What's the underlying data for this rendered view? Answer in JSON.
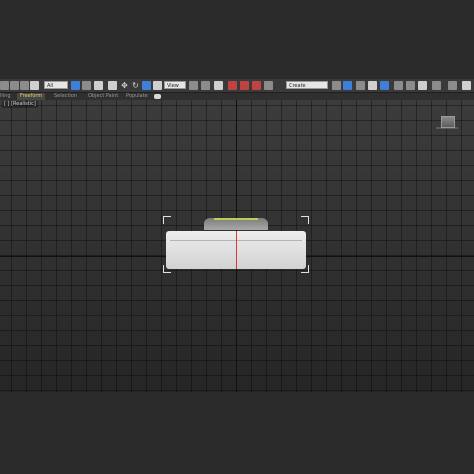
{
  "toolbar": {
    "selection_filter": "All",
    "reference_coordinate": "View",
    "named_selection_set": "Create Selection Se",
    "icons": [
      "undo-icon",
      "redo-icon",
      "link-icon",
      "unlink-icon",
      "bind-spacewarp-icon",
      "select-object-icon",
      "select-by-name-icon",
      "rectangular-selection-icon",
      "window-crossing-icon",
      "select-move-icon",
      "select-rotate-icon",
      "select-scale-icon",
      "place-icon",
      "use-pivot-center-icon",
      "keyboard-shortcut-override-icon",
      "snap-toggle-icon",
      "angle-snap-icon",
      "percent-snap-icon",
      "spinner-snap-icon",
      "edit-named-selection-icon",
      "mirror-icon",
      "align-icon",
      "toggle-scene-explorer-icon",
      "layer-explorer-icon",
      "toggle-ribbon-icon",
      "curve-editor-icon",
      "schematic-view-icon",
      "material-editor-icon",
      "render-setup-icon",
      "rendered-frame-window-icon",
      "render-production-icon"
    ]
  },
  "ribbon": {
    "tabs": [
      "lling",
      "Freeform",
      "Selection",
      "Object Paint",
      "Populate"
    ],
    "active_tab": "Freeform"
  },
  "viewport": {
    "label": "[ ] [Realistic]"
  }
}
